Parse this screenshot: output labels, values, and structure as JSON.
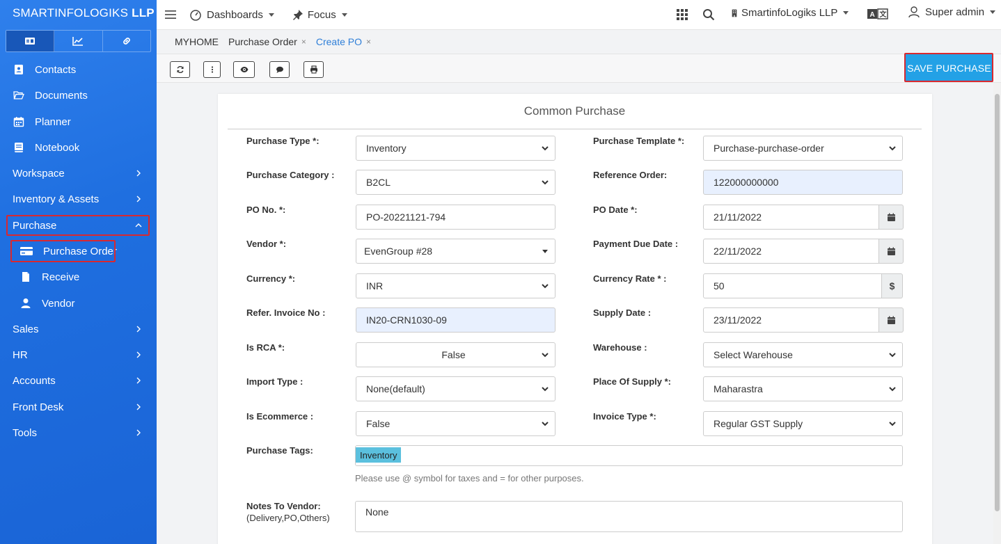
{
  "brand": {
    "name": "SMARTINFOLOGIKS",
    "suffix": "LLP"
  },
  "sidebar": {
    "tabs": [
      {
        "icon": "id-card-icon"
      },
      {
        "icon": "line-chart-icon"
      },
      {
        "icon": "link-icon"
      }
    ],
    "items": [
      {
        "label": "Contacts",
        "icon": "contacts-icon"
      },
      {
        "label": "Documents",
        "icon": "folder-open-icon"
      },
      {
        "label": "Planner",
        "icon": "calendar-icon"
      },
      {
        "label": "Notebook",
        "icon": "notebook-icon"
      },
      {
        "label": "Workspace"
      },
      {
        "label": "Inventory & Assets"
      },
      {
        "label": "Purchase"
      },
      {
        "label": "Purchase Order",
        "icon": "credit-card-icon"
      },
      {
        "label": "Receive",
        "icon": "file-icon"
      },
      {
        "label": "Vendor",
        "icon": "user-icon"
      },
      {
        "label": "Sales"
      },
      {
        "label": "HR"
      },
      {
        "label": "Accounts"
      },
      {
        "label": "Front Desk"
      },
      {
        "label": "Tools"
      }
    ]
  },
  "topbar": {
    "dashboards": "Dashboards",
    "focus": "Focus",
    "company": "SmartinfoLogiks LLP",
    "user": "Super admin"
  },
  "breadcrumbs": {
    "home": "MYHOME",
    "purchase_order": "Purchase Order",
    "create_po": "Create PO",
    "close": "×"
  },
  "toolbar": {
    "save_label": "SAVE PURCHASE"
  },
  "form": {
    "title": "Common Purchase",
    "purchase_type": {
      "label": "Purchase Type *:",
      "value": "Inventory"
    },
    "purchase_template": {
      "label": "Purchase Template *:",
      "value": "Purchase-purchase-order"
    },
    "purchase_category": {
      "label": "Purchase Category :",
      "value": "B2CL"
    },
    "reference_order": {
      "label": "Reference Order:",
      "value": "122000000000"
    },
    "po_no": {
      "label": "PO No. *:",
      "value": "PO-20221121-794"
    },
    "po_date": {
      "label": "PO Date *:",
      "value": "21/11/2022"
    },
    "vendor": {
      "label": "Vendor *:",
      "value": "EvenGroup #28"
    },
    "payment_due_date": {
      "label": "Payment Due Date :",
      "value": "22/11/2022"
    },
    "currency": {
      "label": "Currency *:",
      "value": "INR"
    },
    "currency_rate": {
      "label": "Currency Rate * :",
      "value": "50",
      "addon": "$"
    },
    "refer_invoice": {
      "label": "Refer. Invoice No :",
      "value": "IN20-CRN1030-09"
    },
    "supply_date": {
      "label": "Supply Date :",
      "value": "23/11/2022"
    },
    "is_rca": {
      "label": "Is RCA *:",
      "value": "False"
    },
    "warehouse": {
      "label": "Warehouse :",
      "value": "Select Warehouse"
    },
    "import_type": {
      "label": "Import Type :",
      "value": "None(default)"
    },
    "place_of_supply": {
      "label": "Place Of Supply *:",
      "value": "Maharastra"
    },
    "is_ecommerce": {
      "label": "Is Ecommerce :",
      "value": "False"
    },
    "invoice_type": {
      "label": "Invoice Type *:",
      "value": "Regular GST Supply"
    },
    "purchase_tags": {
      "label": "Purchase Tags:",
      "tag": "Inventory",
      "help": "Please use @ symbol for taxes and = for other purposes."
    },
    "notes": {
      "label": "Notes To Vendor:",
      "label2": "(Delivery,PO,Others)",
      "value": "None"
    }
  },
  "colors": {
    "sidebar": "#1f6fe0",
    "accent": "#23a1e6",
    "highlight": "#d9282f",
    "tag": "#5bc0de"
  }
}
